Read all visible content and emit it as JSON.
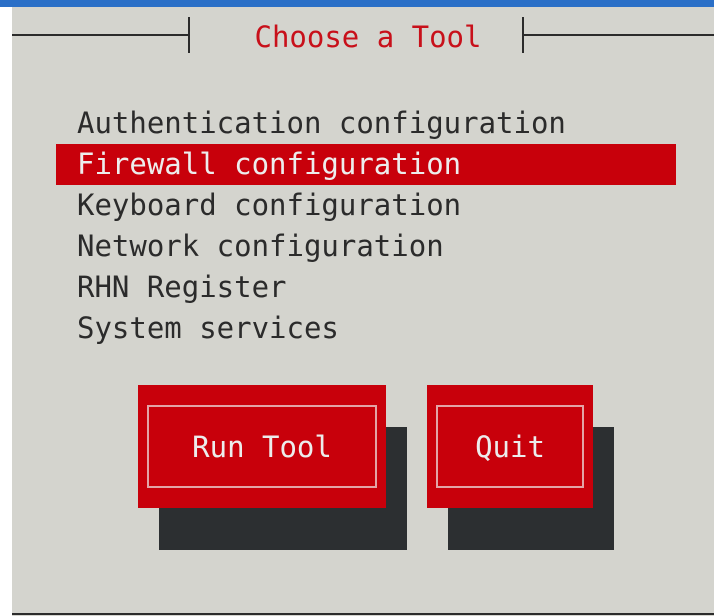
{
  "dialog": {
    "title": "Choose a Tool"
  },
  "menu": {
    "items": [
      {
        "label": "Authentication configuration",
        "selected": false
      },
      {
        "label": "Firewall configuration",
        "selected": true
      },
      {
        "label": "Keyboard configuration",
        "selected": false
      },
      {
        "label": "Network configuration",
        "selected": false
      },
      {
        "label": "RHN Register",
        "selected": false
      },
      {
        "label": "System services",
        "selected": false
      }
    ]
  },
  "buttons": {
    "run_tool": "Run Tool",
    "quit": "Quit"
  },
  "colors": {
    "dialog_background": "#d4d4ce",
    "accent_red": "#c8000b",
    "title_red": "#c8101a",
    "text_dark": "#2b2b2b",
    "shadow": "#2c2f31",
    "top_band": "#2a6fc7"
  }
}
